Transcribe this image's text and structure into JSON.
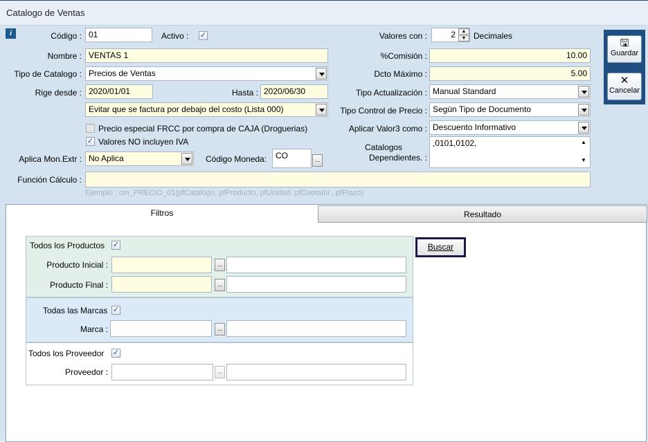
{
  "window": {
    "title": "Catalogo de Ventas"
  },
  "info_icon": "i",
  "form": {
    "codigo_label": "Código :",
    "codigo_value": "01",
    "activo_label": "Activo :",
    "activo_checked": "✓",
    "nombre_label": "Nombre :",
    "nombre_value": "VENTAS 1",
    "tipo_catalogo_label": "Tipo de Catalogo :",
    "tipo_catalogo_value": "Precios de Ventas",
    "rige_desde_label": "Rige desde :",
    "rige_desde_value": "2020/01/01",
    "hasta_label": "Hasta :",
    "hasta_value": "2020/06/30",
    "costo_option": "Evitar que se factura por debajo del costo (Lista 000)",
    "frcc_label": "Precio especial FRCC por compra de CAJA (Droguerias)",
    "iva_label": "Valores NO incluyen IVA",
    "iva_checked": "✓",
    "aplica_mon_label": "Aplica Mon.Extr :",
    "aplica_mon_value": "No Aplica",
    "codigo_moneda_label": "Código Moneda:",
    "codigo_moneda_value": "CO",
    "funcion_label": "Función Cálculo :",
    "funcion_value": "",
    "funcion_hint": "Ejemplo : cm_PRECIO_01(pfCatalogo, pfProducto, pfUnidad, pfCuotaIni , pfPlazo)",
    "valores_con_label": "Valores con :",
    "valores_con_value": "2",
    "decimales_label": "Decimales",
    "comision_label": "%Comisión :",
    "comision_value": "10.00",
    "dcto_label": "Dcto Máximo :",
    "dcto_value": "5.00",
    "tipo_act_label": "Tipo Actualización :",
    "tipo_act_value": "Manual Standard",
    "tipo_ctrl_label": "Tipo Control de Precio :",
    "tipo_ctrl_value": "Según Tipo de Documento",
    "aplicar_v3_label": "Aplicar Valor3 como :",
    "aplicar_v3_value": "Descuento Informativo",
    "cat_dep_label1": "Catalogos",
    "cat_dep_label2": "Dependientes. :",
    "cat_dep_value": ",0101,0102,"
  },
  "side_buttons": {
    "guardar": "Guardar",
    "cancelar": "Cancelar"
  },
  "tabs": {
    "filtros": "Filtros",
    "resultado": "Resultado"
  },
  "filters": {
    "todos_productos_label": "Todos los Productos",
    "todos_productos_checked": "✓",
    "producto_inicial_label": "Producto Inicial :",
    "producto_final_label": "Producto Final :",
    "todas_marcas_label": "Todas las Marcas",
    "todas_marcas_checked": "✓",
    "marca_label": "Marca :",
    "todos_proveedor_label": "Todos los Proveedor",
    "todos_proveedor_checked": "✓",
    "proveedor_label": "Proveedor :",
    "buscar_label": "Buscar"
  },
  "ellipsis": "...",
  "colors": {
    "required": "#fffde1",
    "panel": "#d4e3ef",
    "group_products": "#e3efe9",
    "group_marcas": "#dce9f7"
  }
}
